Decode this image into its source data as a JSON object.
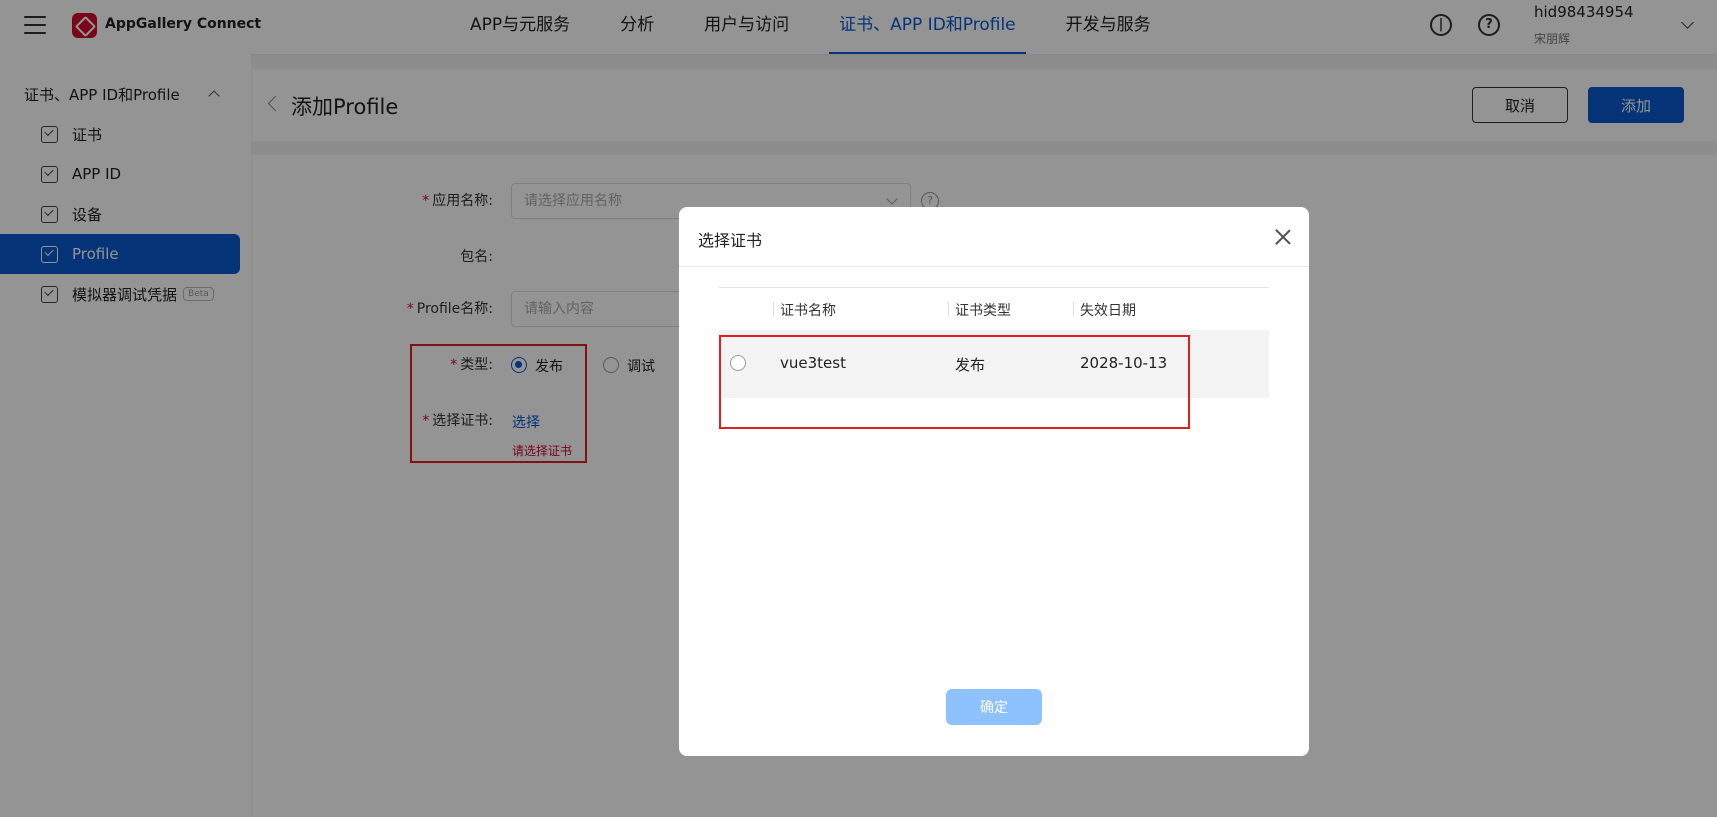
{
  "header": {
    "brand": "AppGallery Connect",
    "nav": [
      "APP与元服务",
      "分析",
      "用户与访问",
      "证书、APP ID和Profile",
      "开发与服务"
    ],
    "active_nav": "证书、APP ID和Profile",
    "user_name": "hid98434954",
    "user_sub": "宋朋辉",
    "icons": [
      "menu-icon",
      "voice-icon",
      "help-icon"
    ]
  },
  "sidebar": {
    "section_title": "证书、APP ID和Profile",
    "items": [
      {
        "label": "证书"
      },
      {
        "label": "APP ID"
      },
      {
        "label": "设备"
      },
      {
        "label": "Profile"
      },
      {
        "label": "模拟器调试凭据",
        "badge": "Beta"
      }
    ],
    "active_item": "Profile"
  },
  "page": {
    "title": "添加Profile",
    "cancel_label": "取消",
    "add_label": "添加"
  },
  "form": {
    "app_name_label": "应用名称:",
    "app_name_placeholder": "请选择应用名称",
    "package_label": "包名:",
    "profile_name_label": "Profile名称:",
    "profile_name_placeholder": "请输入内容",
    "type_label": "类型:",
    "type_options": [
      "发布",
      "调试"
    ],
    "type_selected": "发布",
    "cert_label": "选择证书:",
    "cert_link": "选择",
    "cert_error": "请选择证书",
    "required_mark": "*"
  },
  "modal": {
    "title": "选择证书",
    "columns": [
      "证书名称",
      "证书类型",
      "失效日期"
    ],
    "rows": [
      {
        "name": "vue3test",
        "type": "发布",
        "expiry": "2028-10-13",
        "selected": false
      }
    ],
    "ok_label": "确定"
  },
  "colors": {
    "accent": "#0a59cf",
    "brand_red": "#cf0a2c",
    "annotation_red": "#e02020",
    "ok_disabled": "#8ec2ff"
  }
}
